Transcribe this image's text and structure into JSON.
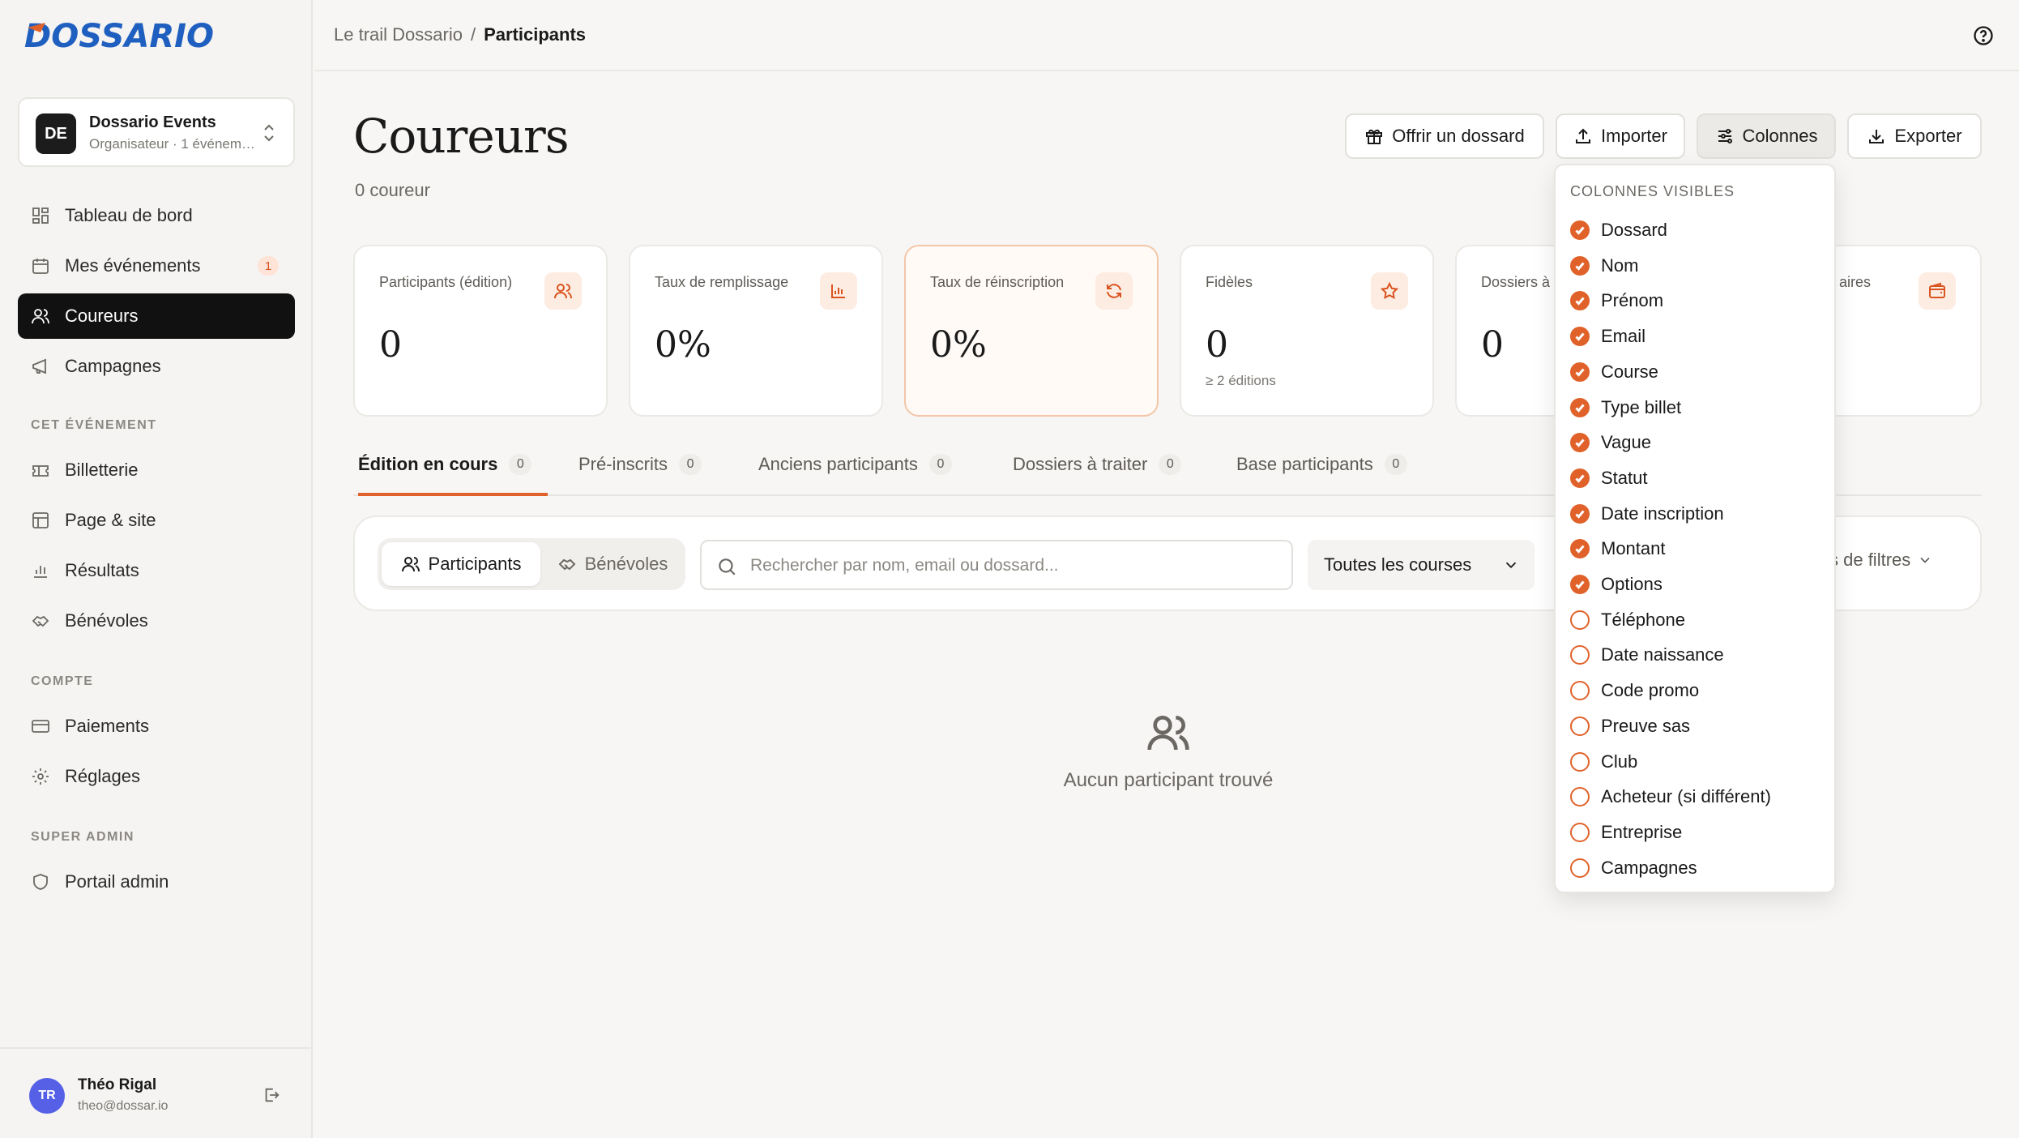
{
  "app": {
    "logo_text": "DOSSARIO"
  },
  "org": {
    "avatar": "DE",
    "name": "Dossario Events",
    "subtitle": "Organisateur · 1 événement"
  },
  "sidebar": {
    "main": [
      {
        "label": "Tableau de bord",
        "icon": "dashboard-icon"
      },
      {
        "label": "Mes événements",
        "icon": "calendar-icon",
        "badge": "1"
      },
      {
        "label": "Coureurs",
        "icon": "users-icon",
        "active": true
      },
      {
        "label": "Campagnes",
        "icon": "megaphone-icon"
      }
    ],
    "section_event": "CET ÉVÉNEMENT",
    "event": [
      {
        "label": "Billetterie",
        "icon": "ticket-icon"
      },
      {
        "label": "Page & site",
        "icon": "layout-icon"
      },
      {
        "label": "Résultats",
        "icon": "bar-chart-icon"
      },
      {
        "label": "Bénévoles",
        "icon": "handshake-icon"
      }
    ],
    "section_account": "COMPTE",
    "account": [
      {
        "label": "Paiements",
        "icon": "credit-card-icon"
      },
      {
        "label": "Réglages",
        "icon": "gear-icon"
      }
    ],
    "section_admin": "SUPER ADMIN",
    "admin": [
      {
        "label": "Portail admin",
        "icon": "shield-icon"
      }
    ]
  },
  "user": {
    "initials": "TR",
    "name": "Théo Rigal",
    "email": "theo@dossar.io"
  },
  "breadcrumb": {
    "parent": "Le trail Dossario",
    "separator": "/",
    "current": "Participants"
  },
  "page": {
    "title": "Coureurs",
    "subtitle": "0 coureur"
  },
  "actions": {
    "offer": "Offrir un dossard",
    "import": "Importer",
    "columns": "Colonnes",
    "export": "Exporter"
  },
  "stats": [
    {
      "label": "Participants (édition)",
      "value": "0",
      "icon": "users-icon"
    },
    {
      "label": "Taux de remplissage",
      "value": "0%",
      "icon": "bar-chart-icon"
    },
    {
      "label": "Taux de réinscription",
      "value": "0%",
      "icon": "refresh-icon"
    },
    {
      "label": "Fidèles",
      "value": "0",
      "note": "≥ 2 éditions",
      "icon": "star-icon"
    },
    {
      "label": "Dossiers à",
      "value": "0",
      "icon": "file-icon"
    },
    {
      "label": "aires",
      "value": "",
      "icon": "wallet-icon"
    }
  ],
  "tabs": [
    {
      "label": "Édition en cours",
      "count": "0",
      "active": true
    },
    {
      "label": "Pré-inscrits",
      "count": "0"
    },
    {
      "label": "Anciens participants",
      "count": "0"
    },
    {
      "label": "Dossiers à traiter",
      "count": "0"
    },
    {
      "label": "Base participants",
      "count": "0"
    }
  ],
  "filters": {
    "segment_participants": "Participants",
    "segment_volunteers": "Bénévoles",
    "search_placeholder": "Rechercher par nom, email ou dossard...",
    "course_select": "Toutes les courses",
    "more_filters": "s de filtres"
  },
  "empty": {
    "text": "Aucun participant trouvé"
  },
  "columns_menu": {
    "header": "COLONNES VISIBLES",
    "items": [
      {
        "label": "Dossard",
        "checked": true
      },
      {
        "label": "Nom",
        "checked": true
      },
      {
        "label": "Prénom",
        "checked": true
      },
      {
        "label": "Email",
        "checked": true
      },
      {
        "label": "Course",
        "checked": true
      },
      {
        "label": "Type billet",
        "checked": true
      },
      {
        "label": "Vague",
        "checked": true
      },
      {
        "label": "Statut",
        "checked": true
      },
      {
        "label": "Date inscription",
        "checked": true
      },
      {
        "label": "Montant",
        "checked": true
      },
      {
        "label": "Options",
        "checked": true
      },
      {
        "label": "Téléphone",
        "checked": false
      },
      {
        "label": "Date naissance",
        "checked": false
      },
      {
        "label": "Code promo",
        "checked": false
      },
      {
        "label": "Preuve sas",
        "checked": false
      },
      {
        "label": "Club",
        "checked": false
      },
      {
        "label": "Acheteur (si différent)",
        "checked": false
      },
      {
        "label": "Entreprise",
        "checked": false
      },
      {
        "label": "Campagnes",
        "checked": false
      }
    ]
  },
  "colors": {
    "accent": "#e0622a",
    "active_nav": "#111111",
    "accent_soft": "#fdece2"
  }
}
